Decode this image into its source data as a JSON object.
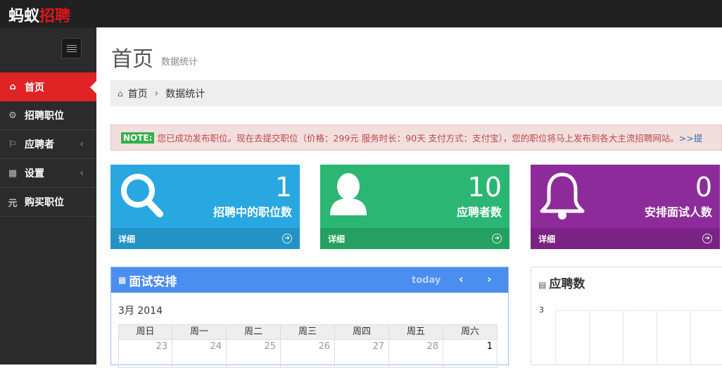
{
  "app": {
    "logo_part1": "蚂蚁",
    "logo_part2": "招聘"
  },
  "sidebar": {
    "items": [
      {
        "label": "首页",
        "icon": "home-icon",
        "active": true
      },
      {
        "label": "招聘职位",
        "icon": "cogs-icon"
      },
      {
        "label": "应聘者",
        "icon": "bookmark-icon",
        "chevron": "‹"
      },
      {
        "label": "设置",
        "icon": "gift-icon",
        "chevron": "‹"
      },
      {
        "label": "购买职位",
        "icon": "yuan-icon"
      }
    ]
  },
  "header": {
    "title": "首页",
    "subtitle": "数据统计"
  },
  "breadcrumb": {
    "home": "首页",
    "sep": "›",
    "current": "数据统计"
  },
  "notice": {
    "tag": "NOTE:",
    "text": "您已成功发布职位。现在去提交职位（价格：299元 服务时长：90天 支付方式：支付宝），您的职位将马上发布到各大主流招聘网站。",
    "link": ">>提"
  },
  "stats": [
    {
      "value": "1",
      "label": "招聘中的职位数",
      "footer": "详细",
      "icon": "search-icon",
      "color": "#29a7e1"
    },
    {
      "value": "10",
      "label": "应聘者数",
      "footer": "详细",
      "icon": "user-icon",
      "color": "#2bb673"
    },
    {
      "value": "0",
      "label": "安排面试人数",
      "footer": "详细",
      "icon": "bell-icon",
      "color": "#8e2b9a"
    }
  ],
  "calendar": {
    "title": "面试安排",
    "today": "today",
    "prev": "‹",
    "next": "›",
    "month": "3月 2014",
    "weekdays": [
      "周日",
      "周一",
      "周二",
      "周三",
      "周四",
      "周五",
      "周六"
    ],
    "days": [
      "23",
      "24",
      "25",
      "26",
      "27",
      "28",
      "1"
    ]
  },
  "applicants_panel": {
    "title": "应聘数",
    "y_tick": "3"
  }
}
